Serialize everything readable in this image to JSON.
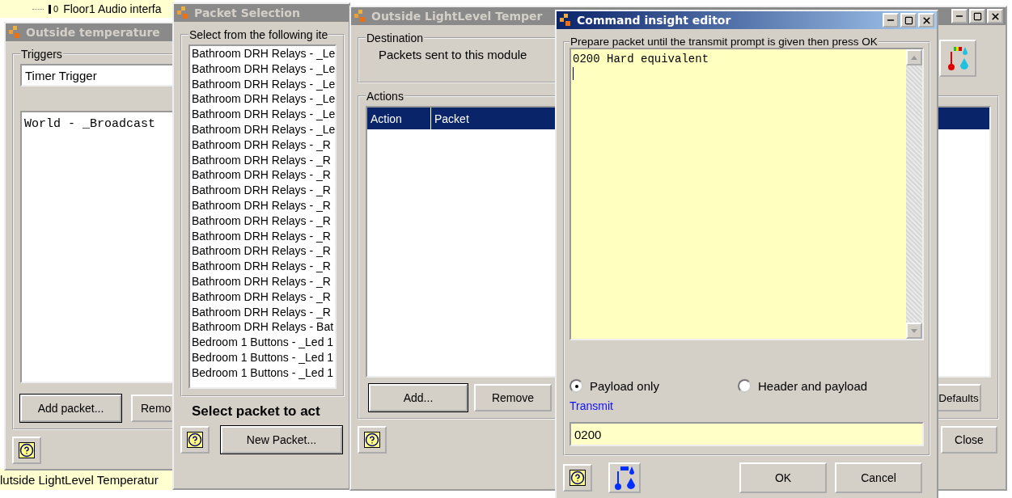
{
  "desktop": {
    "tree_item": {
      "value": "0",
      "label": "Floor1 Audio interfa"
    },
    "status_text": "lutside LightLevel Temperatur"
  },
  "trigger_window": {
    "title": "Outside temperature",
    "active": false,
    "group": "Triggers",
    "trigger": "Timer Trigger",
    "packets": [
      "World - _Broadcast"
    ],
    "buttons": [
      "Add packet...",
      "Remo"
    ]
  },
  "packet_window": {
    "title": "Packet Selection",
    "active": false,
    "group": "Select from the following ite",
    "items": [
      "Bathroom DRH Relays - _Le",
      "Bathroom DRH Relays - _Le",
      "Bathroom DRH Relays - _Le",
      "Bathroom DRH Relays - _Le",
      "Bathroom DRH Relays - _Le",
      "Bathroom DRH Relays - _Le",
      "Bathroom DRH Relays - _R",
      "Bathroom DRH Relays - _R",
      "Bathroom DRH Relays - _R",
      "Bathroom DRH Relays - _R",
      "Bathroom DRH Relays - _R",
      "Bathroom DRH Relays - _R",
      "Bathroom DRH Relays - _R",
      "Bathroom DRH Relays - _R",
      "Bathroom DRH Relays - _R",
      "Bathroom DRH Relays - _R",
      "Bathroom DRH Relays - _R",
      "Bathroom DRH Relays - _R",
      "Bathroom DRH Relays - Bat",
      "Bedroom 1 Buttons - _Led 1",
      "Bedroom 1 Buttons - _Led 1",
      "Bedroom 1 Buttons - _Led 1"
    ],
    "prompt": "Select packet to act",
    "button": "New Packet..."
  },
  "action_window": {
    "title": "Outside LightLevel Temper",
    "active": false,
    "destination": {
      "label": "Destination",
      "text": "Packets sent to this module"
    },
    "actions": {
      "label": "Actions",
      "columns": [
        "Action",
        "Packet"
      ]
    },
    "buttons": {
      "add": "Add...",
      "remove": "Remove",
      "defaults": "Defaults",
      "close": "Close"
    }
  },
  "editor_window": {
    "title": "Command insight editor",
    "active": true,
    "group": "Prepare packet until the transmit prompt is given then press OK",
    "text": "0200 Hard equivalent",
    "modes": [
      {
        "label": "Payload only",
        "selected": true
      },
      {
        "label": "Header and payload",
        "selected": false
      }
    ],
    "transmit_label": "Transmit",
    "transmit_value": "0200",
    "buttons": [
      "OK",
      "Cancel"
    ]
  }
}
